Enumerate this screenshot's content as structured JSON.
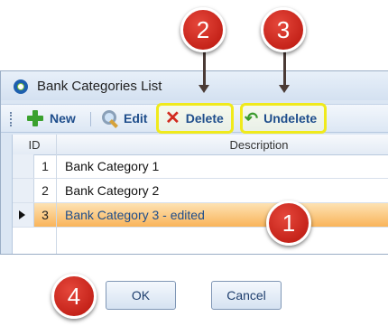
{
  "window": {
    "title": "Bank Categories List"
  },
  "toolbar": {
    "new_label": "New",
    "edit_label": "Edit",
    "delete_label": "Delete",
    "undelete_label": "Undelete"
  },
  "grid": {
    "columns": [
      "ID",
      "Description"
    ],
    "rows": [
      {
        "id": "1",
        "description": "Bank Category 1"
      },
      {
        "id": "2",
        "description": "Bank Category 2"
      },
      {
        "id": "3",
        "description": "Bank Category 3 - edited",
        "selected": true
      }
    ]
  },
  "buttons": {
    "ok_label": "OK",
    "cancel_label": "Cancel"
  },
  "callouts": [
    "1",
    "2",
    "3",
    "4"
  ],
  "colors": {
    "highlight": "#f0ea1c",
    "badge": "#c81d12",
    "selected_row": "#f9b45a"
  }
}
